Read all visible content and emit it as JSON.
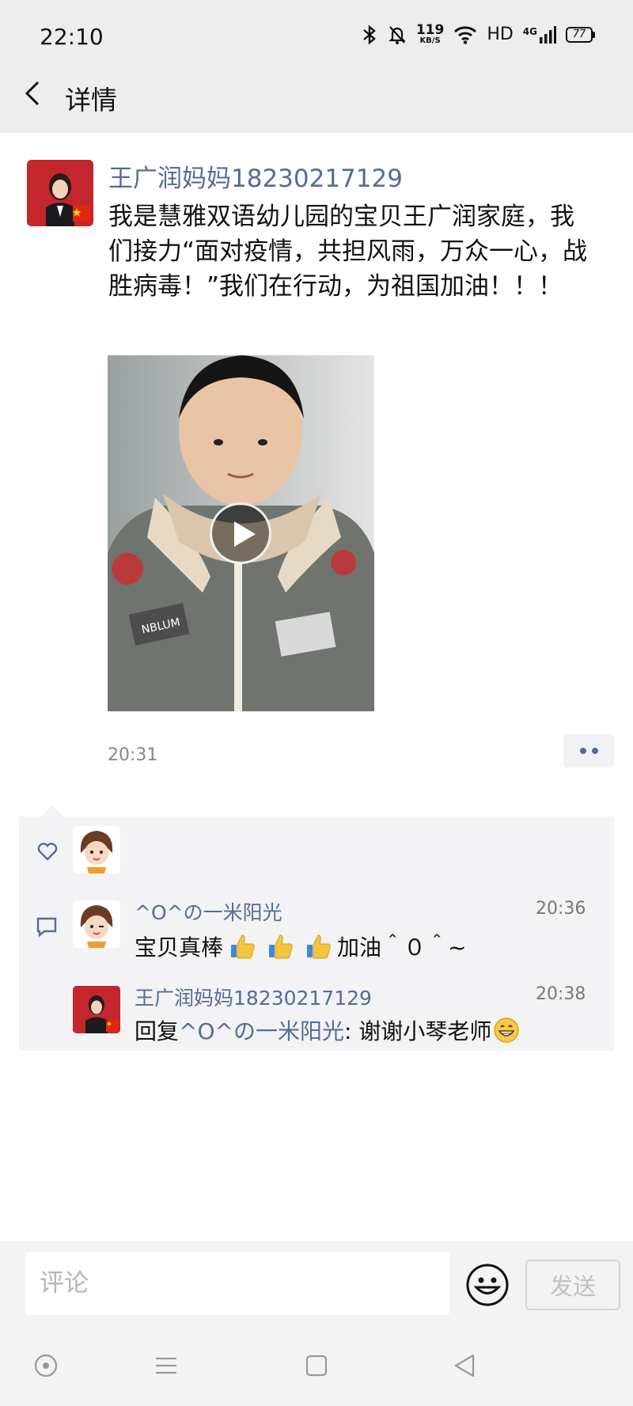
{
  "status_bar": {
    "time": "22:10",
    "speed_value": "119",
    "speed_unit": "KB/S",
    "hd": "HD",
    "network": "4G",
    "battery": "77"
  },
  "header": {
    "title": "详情"
  },
  "post": {
    "author": "王广润妈妈18230217129",
    "text": "我是慧雅双语幼儿园的宝贝王广润家庭，我们接力“面对疫情，共担风雨，万众一心，战胜病毒！”我们在行动，为祖国加油！！！",
    "time": "20:31",
    "video_jacket_patch": "NBLUM"
  },
  "comments": [
    {
      "name": "^O^の一米阳光",
      "time": "20:36",
      "text_before": "宝贝真棒",
      "text_after": "加油＾０＾~"
    },
    {
      "name": "王广润妈妈18230217129",
      "time": "20:38",
      "reply_prefix": "回复",
      "reply_to": "^O^の一米阳光",
      "text": ": 谢谢小琴老师"
    }
  ],
  "input": {
    "placeholder": "评论",
    "send_label": "发送"
  },
  "colors": {
    "link": "#576b95",
    "header_bg": "#ededed",
    "interaction_bg": "#f3f3f5"
  }
}
